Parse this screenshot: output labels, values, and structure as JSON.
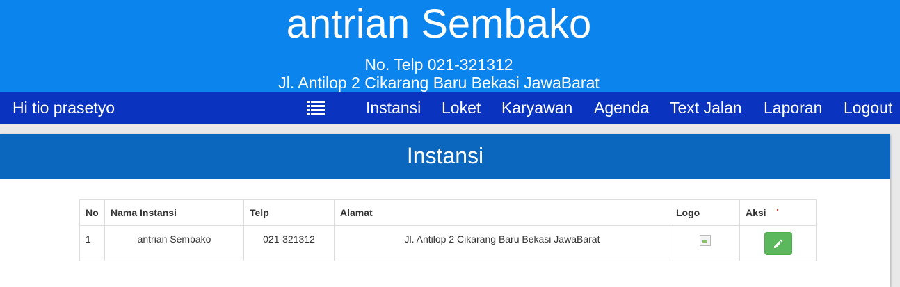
{
  "header": {
    "title": "antrian Sembako",
    "phone": "No. Telp 021-321312",
    "address": "Jl. Antilop 2 Cikarang Baru Bekasi JawaBarat",
    "background_color": "#0b84ee"
  },
  "navbar": {
    "greeting": "Hi tio prasetyo",
    "menu_icon": "list-icon",
    "items": [
      {
        "label": "Instansi"
      },
      {
        "label": "Loket"
      },
      {
        "label": "Karyawan"
      },
      {
        "label": "Agenda"
      },
      {
        "label": "Text Jalan"
      },
      {
        "label": "Laporan"
      },
      {
        "label": "Logout"
      }
    ],
    "background_color": "#0a33bf"
  },
  "panel": {
    "heading": "Instansi",
    "heading_color": "#0a67bd"
  },
  "table": {
    "columns": [
      "No",
      "Nama Instansi",
      "Telp",
      "Alamat",
      "Logo",
      "Aksi"
    ],
    "rows": [
      {
        "no": "1",
        "nama": "antrian Sembako",
        "telp": "021-321312",
        "alamat": "Jl. Antilop 2 Cikarang Baru Bekasi JawaBarat",
        "logo_icon": "broken-image-icon",
        "action_icon": "pencil-icon",
        "action_color": "#5cb85c"
      }
    ]
  }
}
